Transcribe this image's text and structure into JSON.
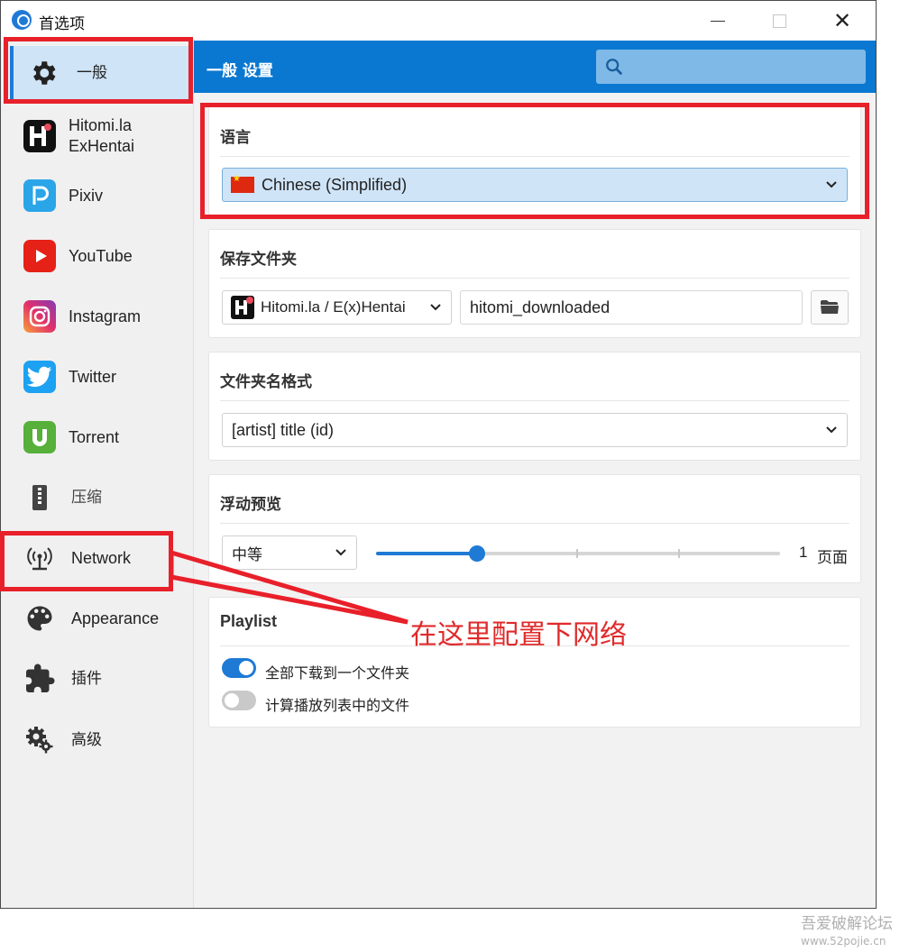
{
  "window": {
    "title": "首选项",
    "controls": {
      "minimize": "minimize",
      "maximize": "maximize",
      "close": "✕"
    }
  },
  "sidebar": {
    "items": [
      {
        "label": "一般",
        "icon": "gear-icon",
        "active": true
      },
      {
        "label": "Hitomi.la\nExHentai",
        "icon": "hitomi-icon"
      },
      {
        "label": "Pixiv",
        "icon": "pixiv-icon"
      },
      {
        "label": "YouTube",
        "icon": "youtube-icon"
      },
      {
        "label": "Instagram",
        "icon": "instagram-icon"
      },
      {
        "label": "Twitter",
        "icon": "twitter-icon"
      },
      {
        "label": "Torrent",
        "icon": "torrent-icon"
      },
      {
        "label": "压缩",
        "icon": "zip-icon"
      },
      {
        "label": "Network",
        "icon": "network-icon"
      },
      {
        "label": "Appearance",
        "icon": "palette-icon"
      },
      {
        "label": "插件",
        "icon": "puzzle-icon"
      },
      {
        "label": "高级",
        "icon": "gears-icon"
      }
    ]
  },
  "header": {
    "title": "一般 设置",
    "search_placeholder": ""
  },
  "language": {
    "title": "语言",
    "selected": "Chinese (Simplified)"
  },
  "save_folder": {
    "title": "保存文件夹",
    "site_selected": "Hitomi.la / E(x)Hentai",
    "folder_value": "hitomi_downloaded"
  },
  "folder_name_format": {
    "title": "文件夹名格式",
    "selected": "[artist] title (id)"
  },
  "floating_preview": {
    "title": "浮动预览",
    "size_selected": "中等",
    "slider_value": 1,
    "slider_fraction": 0.25,
    "value_label": "1",
    "unit_label": "页面"
  },
  "playlist": {
    "title": "Playlist",
    "options": [
      {
        "label": "全部下载到一个文件夹",
        "on": true
      },
      {
        "label": "计算播放列表中的文件",
        "on": false
      }
    ]
  },
  "annotation": {
    "text": "在这里配置下网络",
    "color": "#e8202a"
  },
  "watermark": {
    "line1": "吾爱破解论坛",
    "line2": "www.52pojie.cn"
  },
  "colors": {
    "accent": "#0a78d1",
    "active_nav": "#cfe4f7",
    "annotation_red": "#e8202a"
  }
}
